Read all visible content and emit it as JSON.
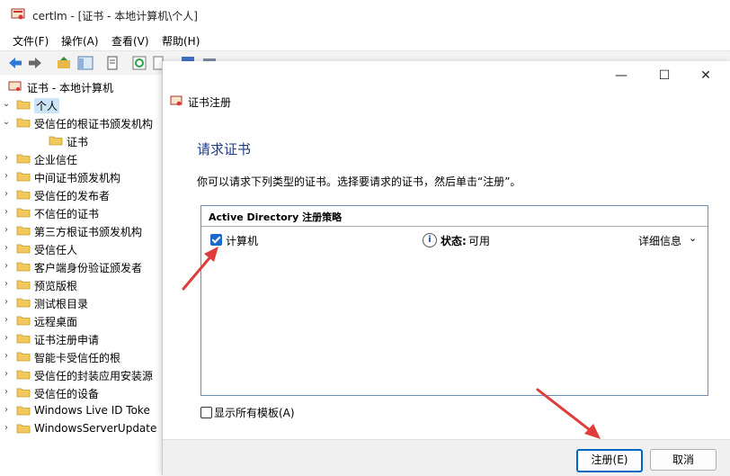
{
  "window": {
    "title": "certlm - [证书 - 本地计算机\\个人]",
    "menu": [
      "文件(F)",
      "操作(A)",
      "查看(V)",
      "帮助(H)"
    ]
  },
  "tree": {
    "root": "证书 - 本地计算机",
    "items": [
      {
        "label": "个人",
        "expanded": true,
        "selected": true
      },
      {
        "label": "受信任的根证书颁发机构",
        "expanded": true
      },
      {
        "label": "证书",
        "child": true
      },
      {
        "label": "企业信任"
      },
      {
        "label": "中间证书颁发机构"
      },
      {
        "label": "受信任的发布者"
      },
      {
        "label": "不信任的证书"
      },
      {
        "label": "第三方根证书颁发机构"
      },
      {
        "label": "受信任人"
      },
      {
        "label": "客户端身份验证颁发者"
      },
      {
        "label": "预览版根"
      },
      {
        "label": "测试根目录"
      },
      {
        "label": "远程桌面"
      },
      {
        "label": "证书注册申请"
      },
      {
        "label": "智能卡受信任的根"
      },
      {
        "label": "受信任的封装应用安装源"
      },
      {
        "label": "受信任的设备"
      },
      {
        "label": "Windows Live ID Toke"
      },
      {
        "label": "WindowsServerUpdate"
      }
    ]
  },
  "dialog": {
    "title": "证书注册",
    "heading": "请求证书",
    "description": "你可以请求下列类型的证书。选择要请求的证书，然后单击“注册”。",
    "policy_header": "Active Directory 注册策略",
    "computer_label": "计算机",
    "status_label": "状态:",
    "status_value": "可用",
    "details": "详细信息",
    "show_all": "显示所有模板(A)",
    "enroll_button": "注册(E)",
    "cancel_button": "取消",
    "minimize_icon": "minimize-icon",
    "maximize_icon": "maximize-icon",
    "close_icon": "close-icon"
  },
  "colors": {
    "accent": "#0067c0",
    "heading": "#1e3b8a",
    "annotation_arrow": "#e03c3c",
    "selection": "#cce4f7"
  }
}
